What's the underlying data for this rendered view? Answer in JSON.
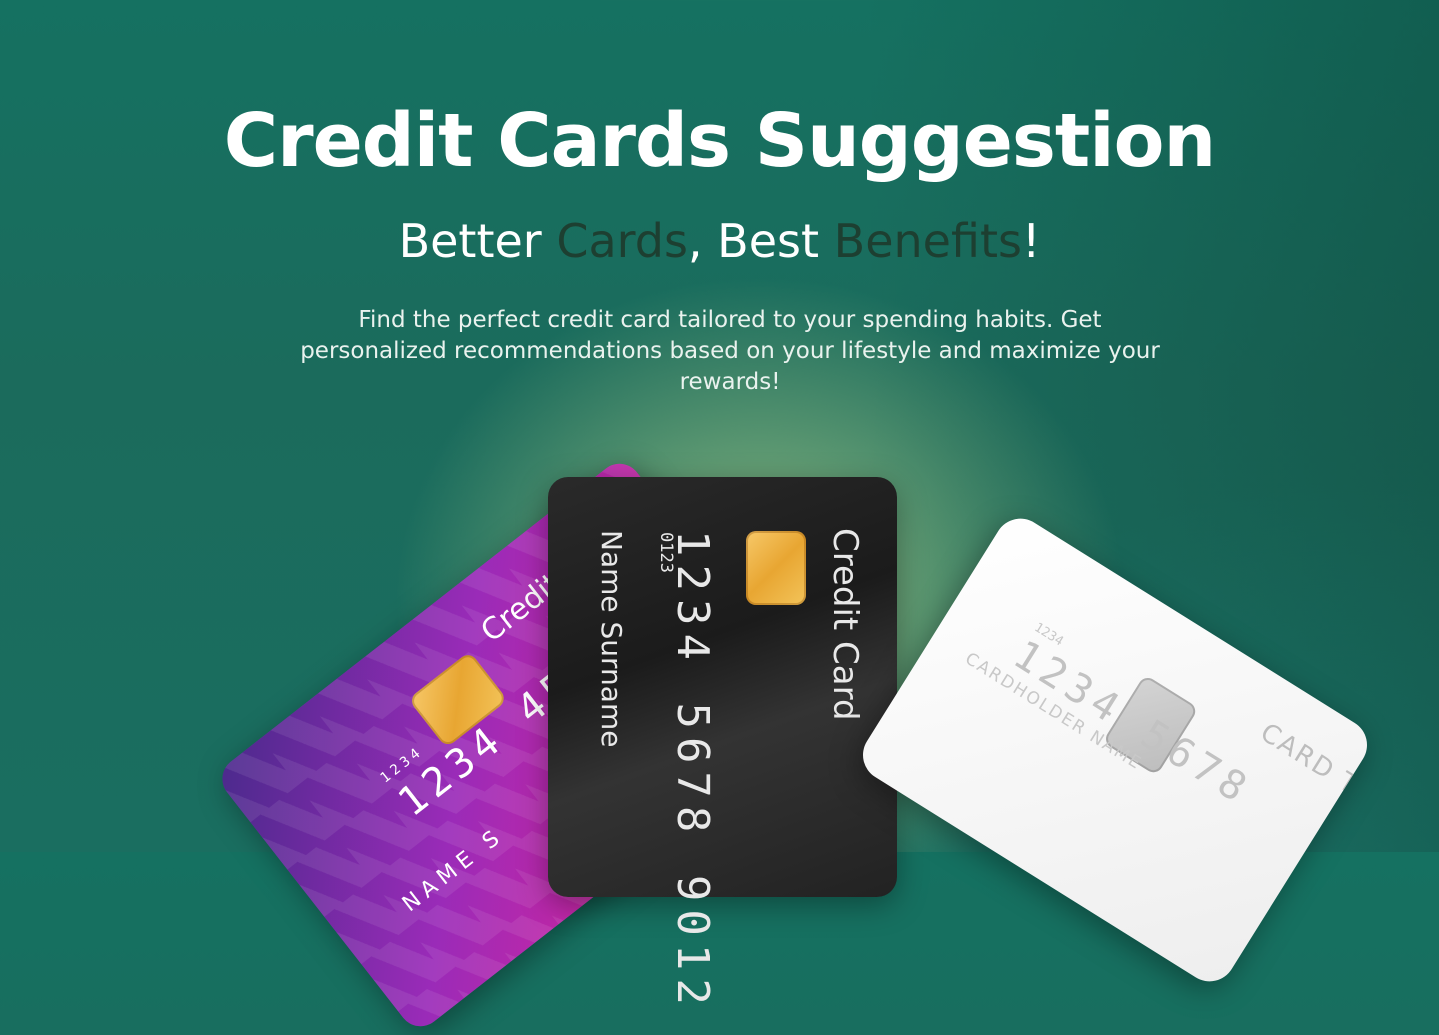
{
  "hero": {
    "title": "Credit Cards Suggestion",
    "subtitle": {
      "part1": "Better ",
      "highlight1": "Cards",
      "part2": ", Best ",
      "highlight2": "Benefits",
      "part3": "!"
    },
    "description": "Find the perfect credit card tailored to your spending habits. Get personalized recommendations based on your lifestyle and maximize your rewards!"
  },
  "cards": {
    "purple": {
      "label": "Credit card",
      "number": "1234 456",
      "small_number": "1234",
      "name": "NAME S"
    },
    "black": {
      "label": "Credit Card",
      "number": "1234 5678 9012",
      "small_number": "0123",
      "name": "Name Surname"
    },
    "white": {
      "type": "CARD TYPE",
      "number": "1234 5678",
      "small_number": "1234",
      "holder": "CARDHOLDER NAME"
    }
  },
  "colors": {
    "accent_dark": "#1d3f31",
    "text_white": "#ffffff"
  }
}
